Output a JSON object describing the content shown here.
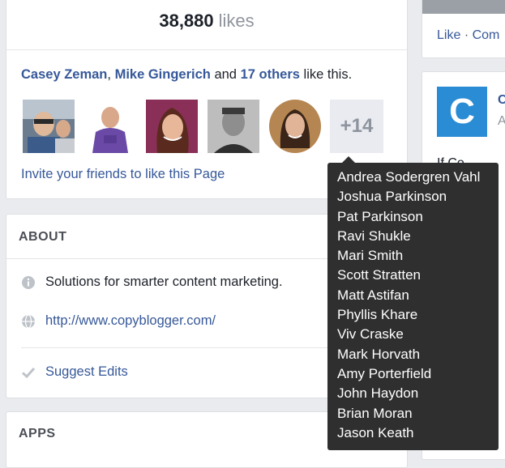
{
  "likes": {
    "count": "38,880",
    "word": "likes"
  },
  "friends_line": {
    "name1": "Casey Zeman",
    "sep": ",",
    "name2": "Mike Gingerich",
    "and": "and",
    "others": "17 others",
    "suffix": "like this."
  },
  "more_count": "+14",
  "invite_label": "Invite your friends to like this Page",
  "about": {
    "heading": "ABOUT",
    "description": "Solutions for smarter content marketing.",
    "url": "http://www.copyblogger.com/",
    "suggest_label": "Suggest Edits"
  },
  "apps": {
    "heading": "APPS"
  },
  "right": {
    "like_label": "Like",
    "separator": "·",
    "comment_label": "Com",
    "logo_letter": "C",
    "peek_text_1": "C",
    "peek_text_2": "A",
    "peek_text_3": "If Co"
  },
  "tooltip": {
    "names": [
      "Andrea Sodergren Vahl",
      "Joshua Parkinson",
      "Pat Parkinson",
      "Ravi Shukle",
      "Mari Smith",
      "Scott Stratten",
      "Matt Astifan",
      "Phyllis Khare",
      "Viv Craske",
      "Mark Horvath",
      "Amy Porterfield",
      "John Haydon",
      "Brian Moran",
      "Jason Keath"
    ]
  },
  "colors": {
    "link": "#365899",
    "tooltip_bg": "#2f2f2f",
    "logo_bg": "#2a8cd4"
  },
  "icons": [
    "info-icon",
    "globe-icon",
    "check-icon"
  ]
}
